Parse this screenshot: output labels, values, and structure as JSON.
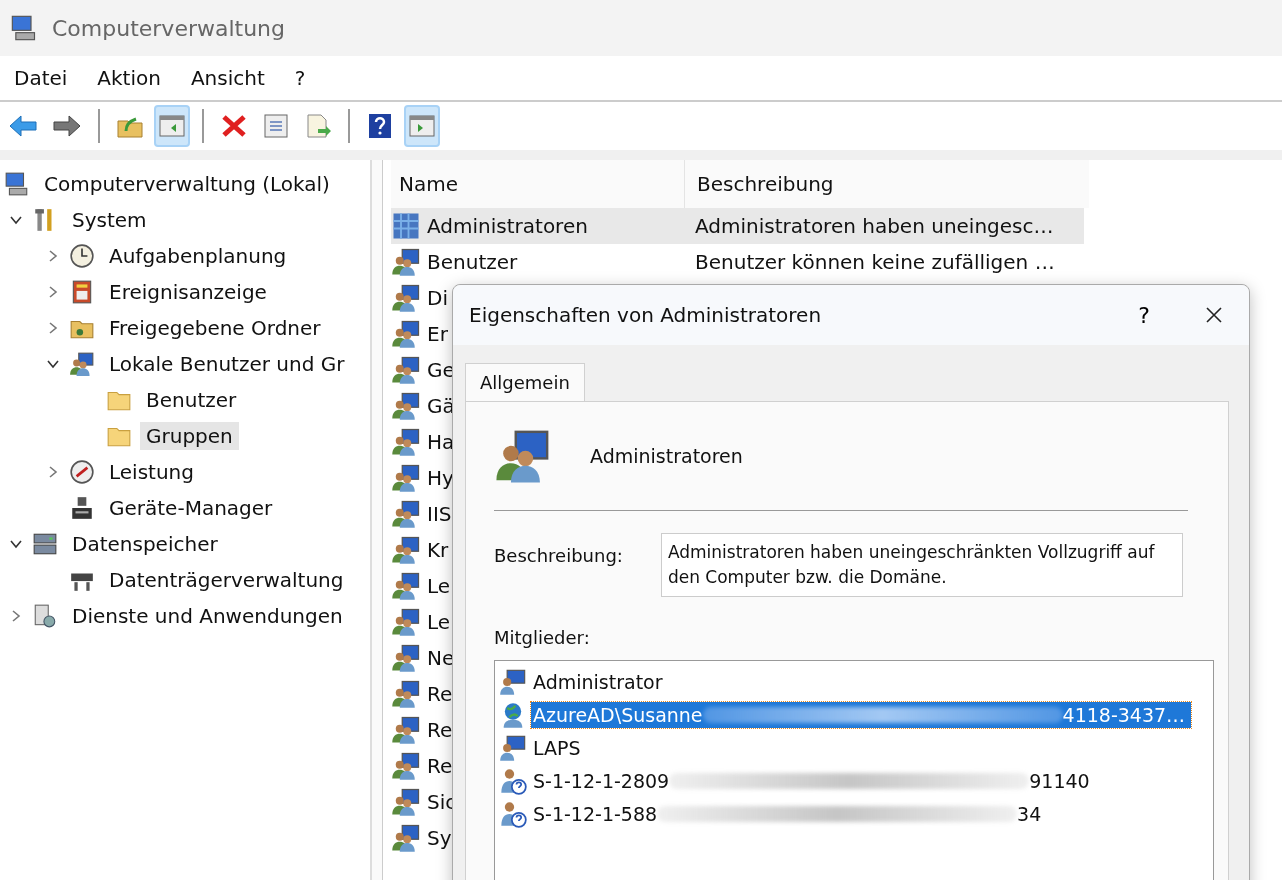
{
  "window": {
    "title": "Computerverwaltung"
  },
  "menu": [
    "Datei",
    "Aktion",
    "Ansicht",
    "?"
  ],
  "toolbar": [
    {
      "kind": "back",
      "selected": false
    },
    {
      "kind": "forward",
      "selected": false
    },
    {
      "kind": "sep"
    },
    {
      "kind": "up",
      "selected": false
    },
    {
      "kind": "tree",
      "selected": true
    },
    {
      "kind": "sep"
    },
    {
      "kind": "delete",
      "selected": false
    },
    {
      "kind": "properties",
      "selected": false
    },
    {
      "kind": "export",
      "selected": false
    },
    {
      "kind": "sep"
    },
    {
      "kind": "help",
      "selected": false
    },
    {
      "kind": "action",
      "selected": true
    }
  ],
  "tree": [
    {
      "label": "Computerverwaltung (Lokal)",
      "kind": "computer",
      "selected": false,
      "children": [
        {
          "label": "System",
          "kind": "tools",
          "expanded": true,
          "selected": false,
          "children": [
            {
              "label": "Aufgabenplanung",
              "kind": "clock",
              "expanded": false,
              "selected": false
            },
            {
              "label": "Ereignisanzeige",
              "kind": "event",
              "expanded": false,
              "selected": false
            },
            {
              "label": "Freigegebene Ordner",
              "kind": "share",
              "expanded": false,
              "selected": false
            },
            {
              "label": "Lokale Benutzer und Gr",
              "kind": "users",
              "expanded": true,
              "selected": false,
              "children": [
                {
                  "label": "Benutzer",
                  "kind": "folder",
                  "selected": false
                },
                {
                  "label": "Gruppen",
                  "kind": "folder",
                  "selected": true
                }
              ]
            },
            {
              "label": "Leistung",
              "kind": "perf",
              "expanded": false,
              "selected": false
            },
            {
              "label": "Geräte-Manager",
              "kind": "device",
              "selected": false
            }
          ]
        },
        {
          "label": "Datenspeicher",
          "kind": "storage",
          "expanded": true,
          "selected": false,
          "children": [
            {
              "label": "Datenträgerverwaltung",
              "kind": "disk",
              "selected": false
            }
          ]
        },
        {
          "label": "Dienste und Anwendungen",
          "kind": "services",
          "expanded": false,
          "selected": false
        }
      ]
    }
  ],
  "list": {
    "columns": [
      "Name",
      "Beschreibung"
    ],
    "rows": [
      {
        "name": "Administratoren",
        "description": "Administratoren haben uneingesc…",
        "selected": true
      },
      {
        "name": "Benutzer",
        "description": "Benutzer können keine zufälligen …",
        "selected": false
      },
      {
        "name": "Di",
        "selected": false
      },
      {
        "name": "Er",
        "selected": false
      },
      {
        "name": "Ge",
        "selected": false
      },
      {
        "name": "Gä",
        "selected": false
      },
      {
        "name": "Ha",
        "selected": false
      },
      {
        "name": "Hy",
        "selected": false
      },
      {
        "name": "IIS",
        "selected": false
      },
      {
        "name": "Kr",
        "selected": false
      },
      {
        "name": "Le",
        "selected": false
      },
      {
        "name": "Le",
        "selected": false
      },
      {
        "name": "Ne",
        "selected": false
      },
      {
        "name": "Re",
        "selected": false
      },
      {
        "name": "Re",
        "selected": false
      },
      {
        "name": "Re",
        "selected": false
      },
      {
        "name": "Sic",
        "selected": false
      },
      {
        "name": "Sy",
        "selected": false
      }
    ]
  },
  "dialog": {
    "title": "Eigenschaften von Administratoren",
    "help": "?",
    "tabs": [
      {
        "label": "Allgemein",
        "selected": true
      }
    ],
    "group_name": "Administratoren",
    "description_label": "Beschreibung:",
    "description": "Administratoren haben uneingeschränkten Vollzugriff auf den Computer bzw. die Domäne.",
    "members_label": "Mitglieder:",
    "members": [
      {
        "kind": "user",
        "text": "Administrator",
        "redacted": false,
        "selected": false
      },
      {
        "kind": "azure",
        "text": "AzureAD\\Susanne",
        "redacted": true,
        "text_end": "4118-3437…",
        "selected": true
      },
      {
        "kind": "user",
        "text": "LAPS",
        "redacted": false,
        "selected": false
      },
      {
        "kind": "unknown",
        "text": "S-1-12-1-2809",
        "redacted": true,
        "text_end": "91140",
        "selected": false
      },
      {
        "kind": "unknown",
        "text": "S-1-12-1-588",
        "redacted": true,
        "text_end": "34",
        "selected": false
      }
    ]
  }
}
